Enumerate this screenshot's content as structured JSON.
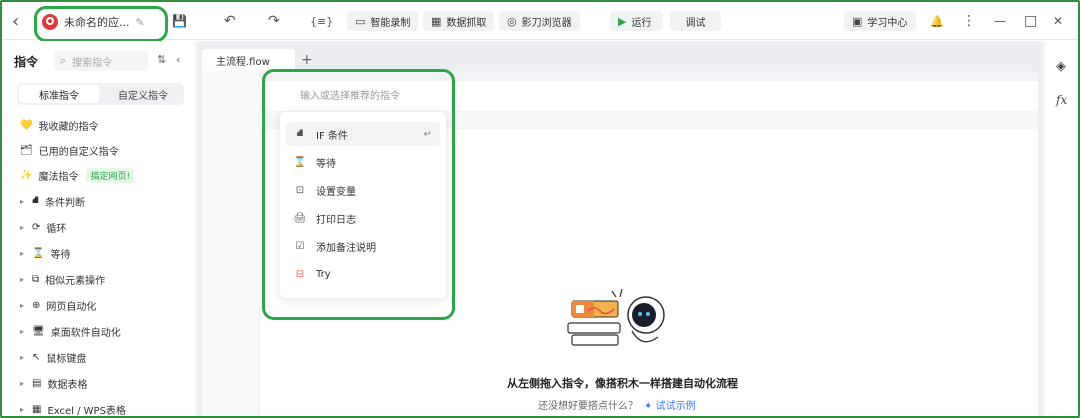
{
  "topbar": {
    "title": "未命名的应...",
    "buttons": {
      "record": "智能录制",
      "scrape": "数据抓取",
      "browser": "影刀浏览器",
      "run": "运行",
      "debug": "调试",
      "learn": "学习中心"
    },
    "icons": {
      "back": "‹",
      "edit": "✎",
      "save": "💾",
      "undo": "↶",
      "redo": "↷",
      "vars": "{≡}",
      "bell": "🔔",
      "more": "⋮",
      "min": "—",
      "max": "□",
      "close": "✕"
    }
  },
  "left": {
    "header": "指令",
    "search_placeholder": "搜索指令",
    "tabs": {
      "standard": "标准指令",
      "custom": "自定义指令"
    },
    "quick": [
      {
        "label": "我收藏的指令",
        "icon": "💛"
      },
      {
        "label": "已用的自定义指令",
        "icon": "🗂"
      },
      {
        "label": "魔法指令",
        "icon": "✨",
        "badge": "搞定网页!"
      }
    ],
    "groups": [
      {
        "label": "条件判断",
        "icon": "⛘"
      },
      {
        "label": "循环",
        "icon": "⟳"
      },
      {
        "label": "等待",
        "icon": "⌛"
      },
      {
        "label": "相似元素操作",
        "icon": "⧉"
      },
      {
        "label": "网页自动化",
        "icon": "⊕"
      },
      {
        "label": "桌面软件自动化",
        "icon": "🖥"
      },
      {
        "label": "鼠标键盘",
        "icon": "↖"
      },
      {
        "label": "数据表格",
        "icon": "▤"
      },
      {
        "label": "Excel / WPS表格",
        "icon": "▦"
      }
    ]
  },
  "editor": {
    "tab": "主流程.flow",
    "add": "+",
    "input_placeholder": "输入或选择推荐的指令",
    "dropdown": [
      {
        "label": "IF 条件",
        "icon": "⛘",
        "enter": "↵"
      },
      {
        "label": "等待",
        "icon": "⌛"
      },
      {
        "label": "设置变量",
        "icon": "⊡"
      },
      {
        "label": "打印日志",
        "icon": "🖨"
      },
      {
        "label": "添加备注说明",
        "icon": "☑"
      },
      {
        "label": "Try",
        "icon": "⊟"
      }
    ],
    "empty": {
      "title": "从左侧拖入指令，像搭积木一样搭建自动化流程",
      "question": "还没想好要搭点什么？",
      "link": "试试示例",
      "link_icon": "✦"
    }
  },
  "right": {
    "layers_icon": "◈",
    "fx_icon": "fx"
  }
}
